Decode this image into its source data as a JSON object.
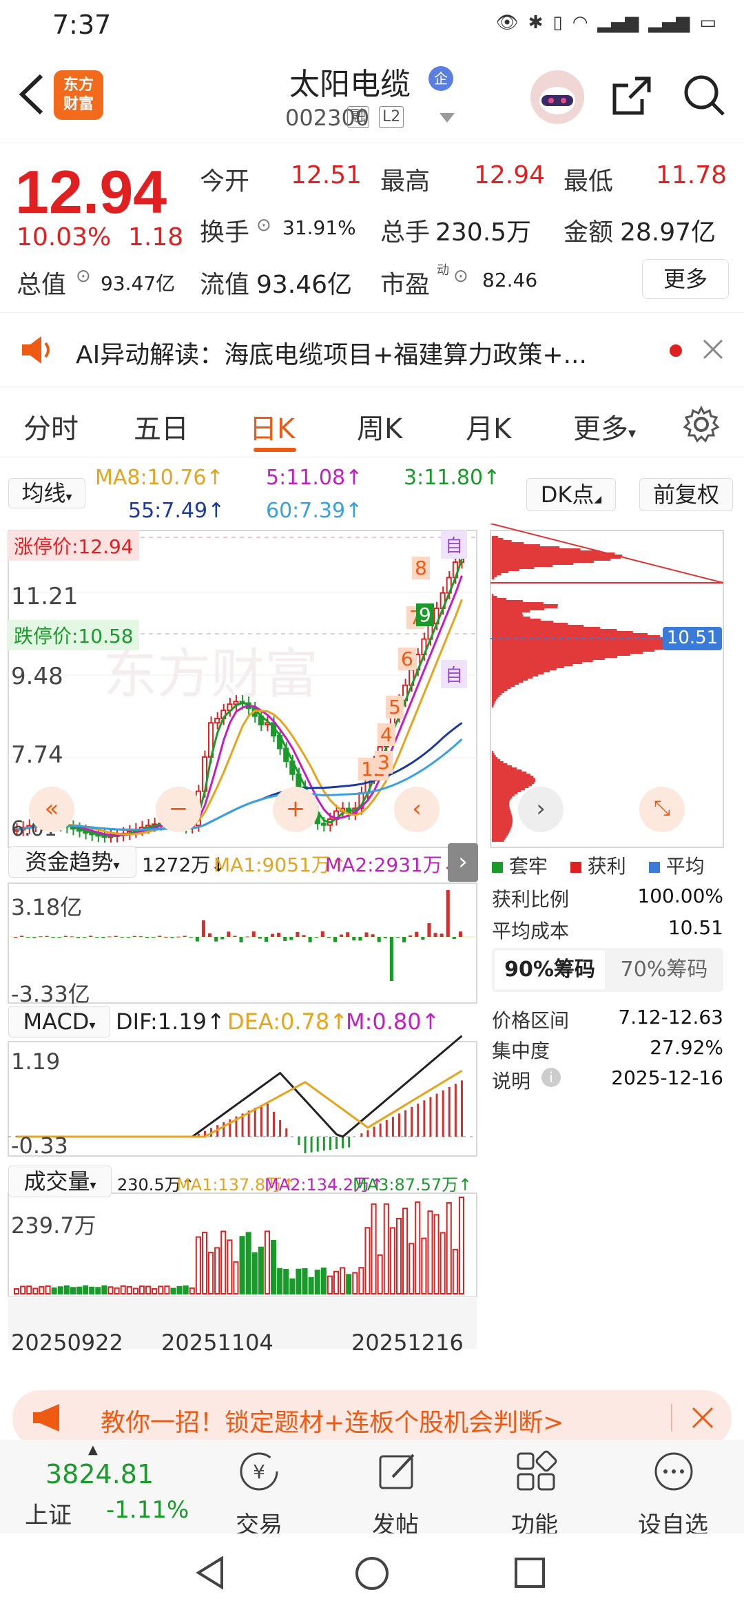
{
  "status": {
    "time": "7:37"
  },
  "header": {
    "logo_line1": "东方",
    "logo_line2": "财富",
    "stock_name": "太阳电缆",
    "badge": "企",
    "code": "002300",
    "tag_rong": "融",
    "tag_l2": "L2"
  },
  "quote": {
    "price": "12.94",
    "pct": "10.03%",
    "change": "1.18",
    "open_label": "今开",
    "open": "12.51",
    "high_label": "最高",
    "high": "12.94",
    "low_label": "最低",
    "low": "11.78",
    "turnover_label": "换手",
    "turnover": "31.91%",
    "volume_label": "总手",
    "volume": "230.5万",
    "amount_label": "金额",
    "amount": "28.97亿",
    "mktcap_label": "总值",
    "mktcap": "93.47亿",
    "float_label": "流值",
    "float": "93.46亿",
    "pe_label": "市盈",
    "pe_sup": "动",
    "pe": "82.46",
    "more": "更多"
  },
  "ai": {
    "text": "AI异动解读：海底电缆项目+福建算力政策+..."
  },
  "tabs": [
    "分时",
    "五日",
    "日K",
    "周K",
    "月K",
    "更多"
  ],
  "chart_controls": {
    "ma_btn": "均线",
    "dk_btn": "DK点",
    "fq_btn": "前复权",
    "ma8": "MA8:10.76↑",
    "ma5": "5:11.08↑",
    "ma3": "3:11.80↑",
    "ma55": "55:7.49↑",
    "ma60": "60:7.39↑"
  },
  "kline": {
    "limit_up": "涨停价:12.94",
    "limit_down": "跌停价:10.58",
    "y_labels": [
      "11.21",
      "9.48",
      "7.74",
      "6.01"
    ],
    "watermark": "东方财富",
    "self_label": "自",
    "cost_line": "10.51"
  },
  "fund": {
    "title": "资金趋势",
    "value": "1272万↓",
    "ma1": "MA1:9051万↑",
    "ma2": "MA2:2931万↓",
    "top": "3.18亿",
    "bottom": "-3.33亿"
  },
  "macd": {
    "title": "MACD",
    "dif": "DIF:1.19↑",
    "dea": "DEA:0.78↑",
    "m": "M:0.80↑",
    "top": "1.19",
    "bottom": "-0.33"
  },
  "vol": {
    "title": "成交量",
    "value": "230.5万↑",
    "ma1": "MA1:137.8万↑",
    "ma2": "MA2:134.2万↑",
    "ma3": "MA3:87.57万↑",
    "top": "239.7万"
  },
  "x_dates": [
    "20250922",
    "20251104",
    "20251216"
  ],
  "chip": {
    "legend": [
      "套牢",
      "获利",
      "平均"
    ],
    "profit_label": "获利比例",
    "profit": "100.00%",
    "avg_label": "平均成本",
    "avg": "10.51",
    "tab90": "90%筹码",
    "tab70": "70%筹码",
    "range_label": "价格区间",
    "range": "7.12-12.63",
    "conc_label": "集中度",
    "conc": "27.92%",
    "note_label": "说明",
    "note": "2025-12-16"
  },
  "promo": {
    "text": "教你一招！锁定题材+连板个股机会判断>"
  },
  "bottom": {
    "index": "3824.81",
    "index_name": "上证",
    "index_pct": "-1.11%",
    "nav": [
      "交易",
      "发帖",
      "功能",
      "设自选"
    ]
  },
  "colors": {
    "up": "#e02020",
    "down": "#1a9a2a",
    "accent": "#ef5a13"
  }
}
